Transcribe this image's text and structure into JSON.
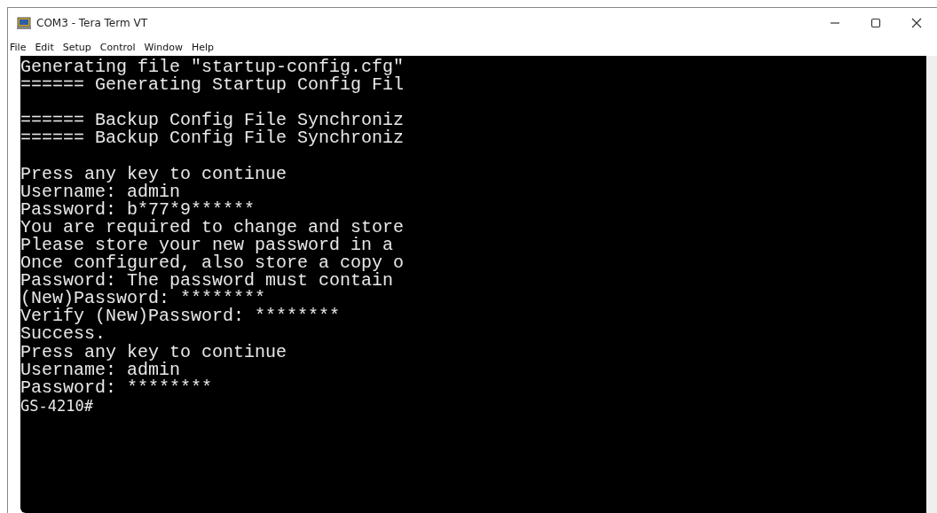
{
  "window": {
    "title": "COM3 - Tera Term VT"
  },
  "menu": [
    "File",
    "Edit",
    "Setup",
    "Control",
    "Window",
    "Help"
  ],
  "terminal": {
    "blocks": [
      [
        "Generating file \"startup-config.cfg\"",
        "====== Generating Startup Config Fil"
      ],
      [
        "====== Backup Config File Synchroniz",
        "====== Backup Config File Synchroniz"
      ],
      [
        "Press any key to continue",
        "Username: admin",
        "Password: b*77*9******",
        "You are required to change and store",
        "Please store your new password in a",
        "Once configured, also store a copy o",
        "Password: The password must contain",
        "(New)Password: ********",
        "Verify (New)Password: ********",
        "Success.",
        "Press any key to continue",
        "Username: admin",
        "Password: ********"
      ]
    ],
    "prompt": "GS-4210#"
  }
}
